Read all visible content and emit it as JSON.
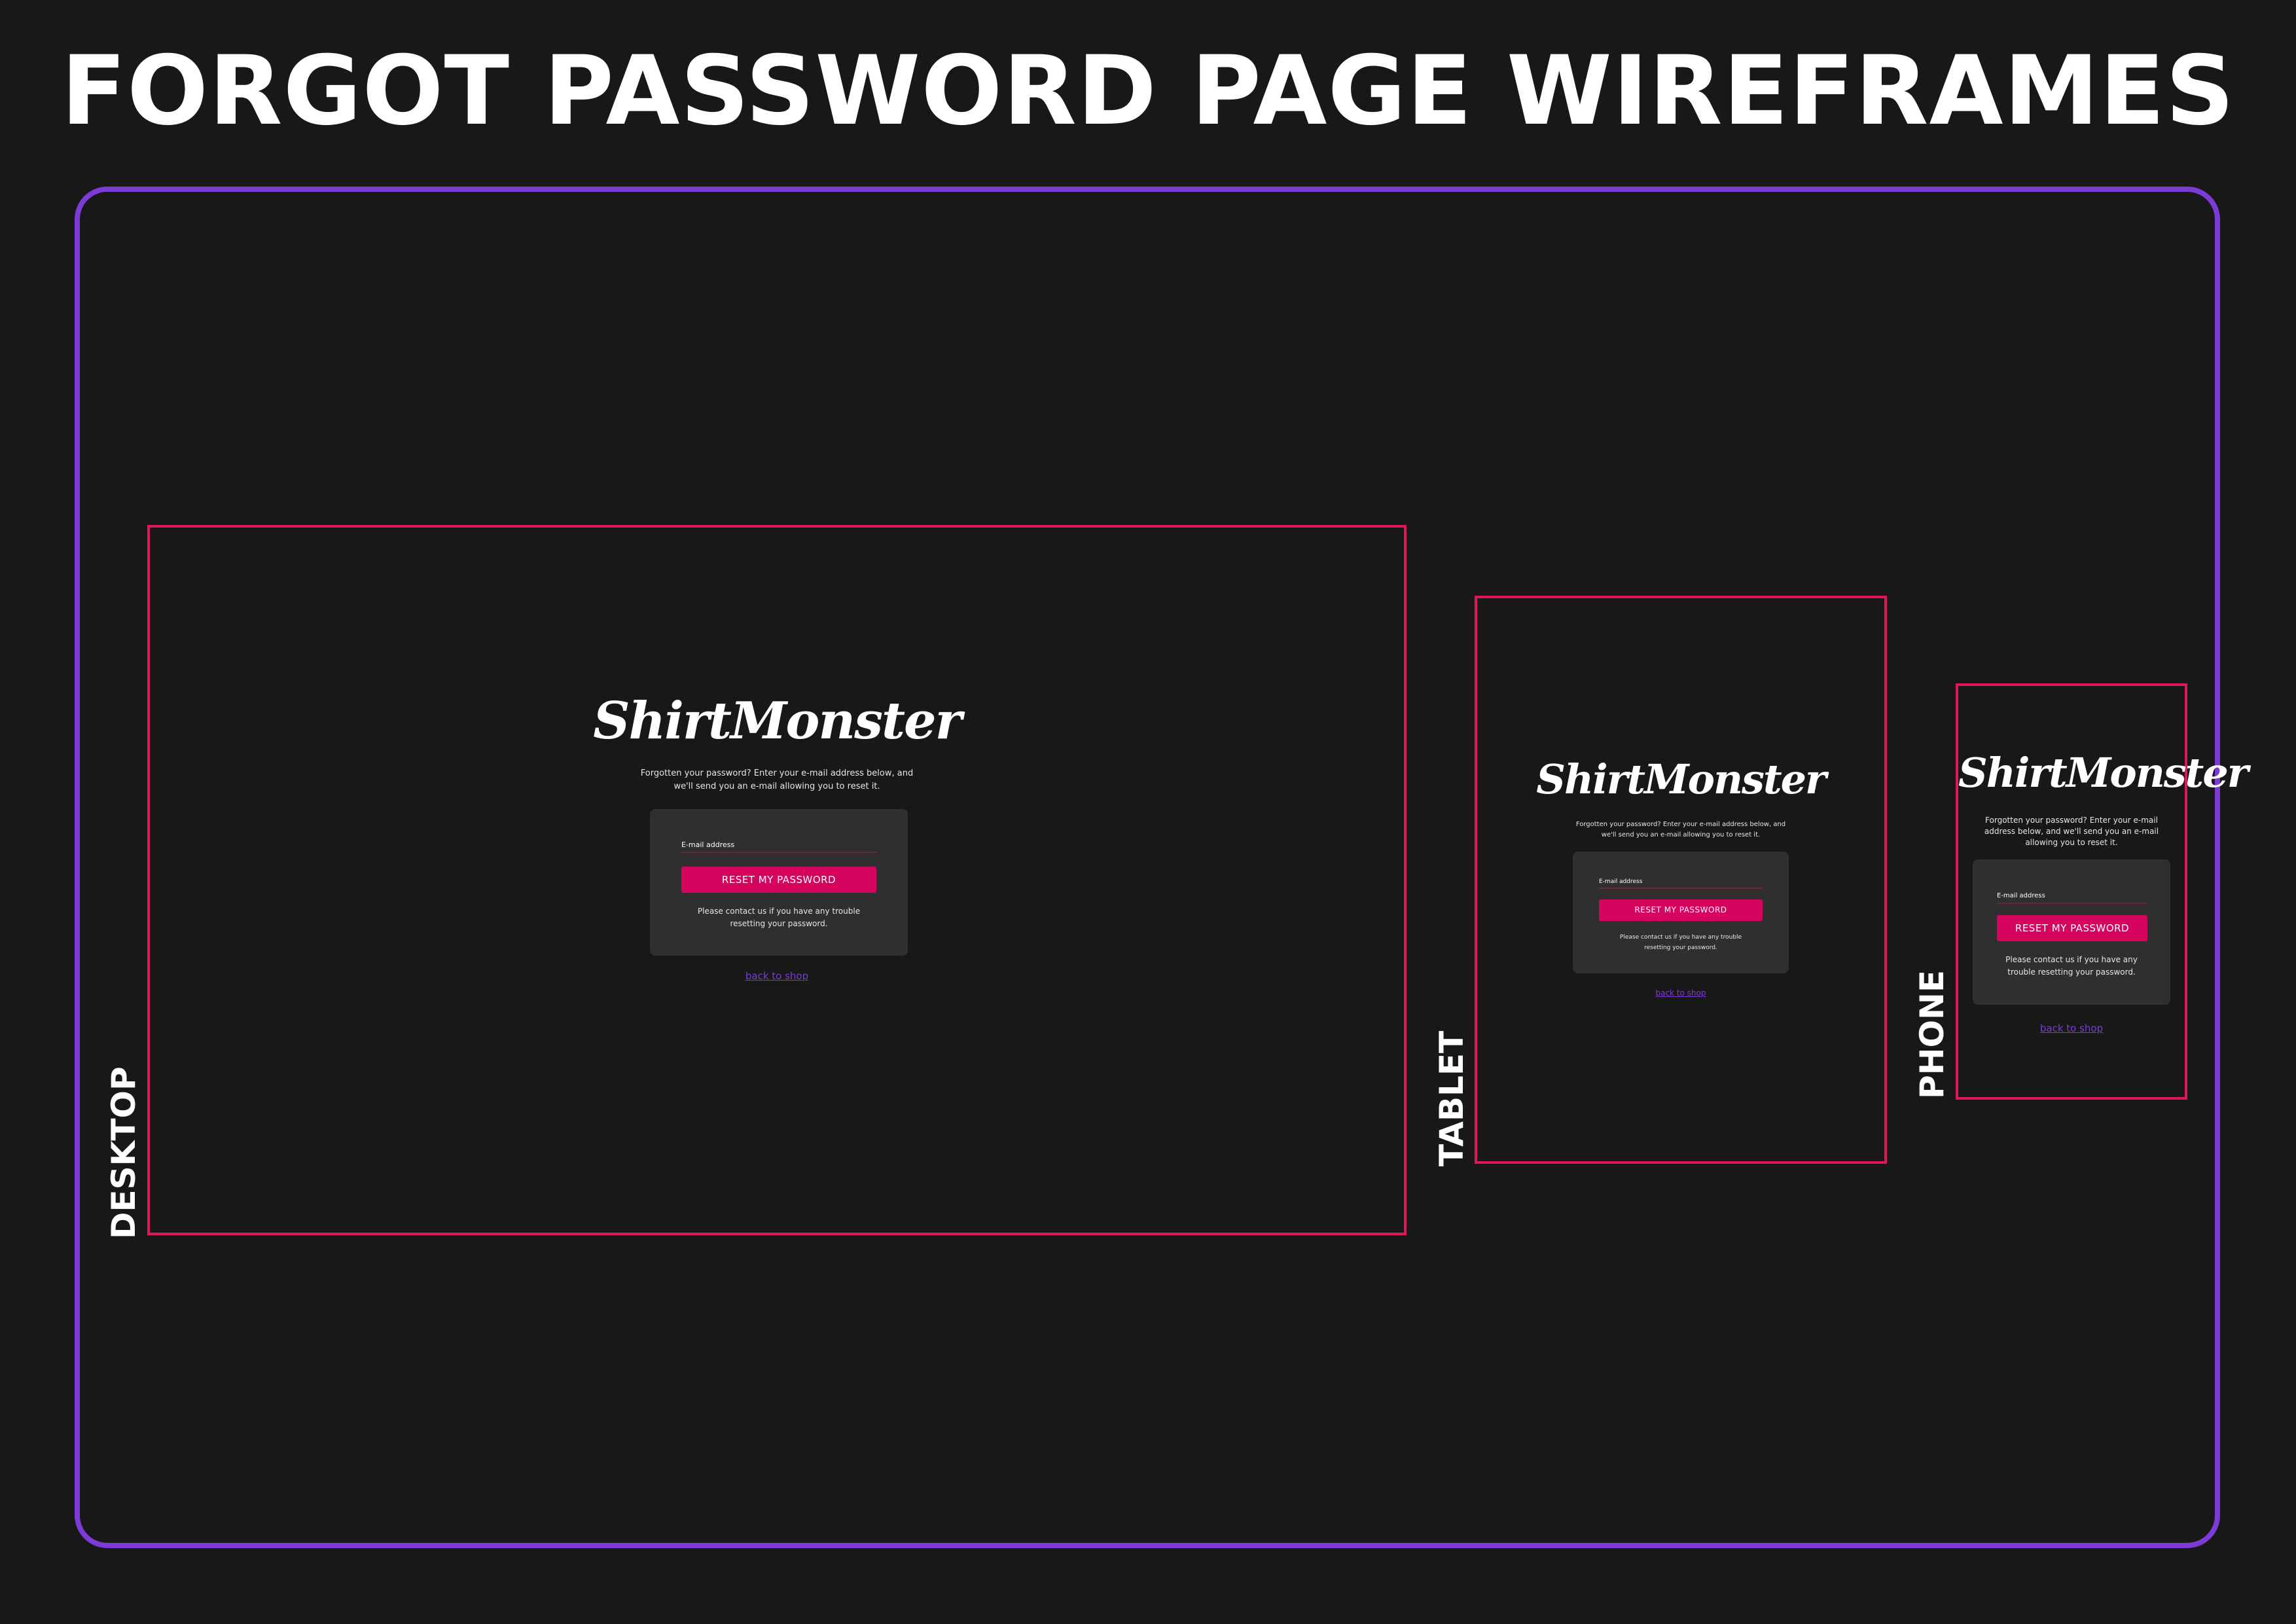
{
  "page": {
    "title": "FORGOT PASSWORD PAGE WIREFRAMES"
  },
  "colors": {
    "background": "#181818",
    "outer_frame": "#7c3bd5",
    "device_frame": "#e0175d",
    "card": "#2f2f2f",
    "button": "#d6045f",
    "link": "#7c3bd5"
  },
  "desktop": {
    "label": "DESKTOP",
    "logo": "ShirtMonster",
    "intro": "Forgotten your password? Enter your e-mail address below, and\nwe'll send you an e-mail allowing you to reset it.",
    "email_label": "E-mail address",
    "button": "RESET MY PASSWORD",
    "help": "Please contact us if you have any trouble\nresetting your password.",
    "back_link": "back to shop"
  },
  "tablet": {
    "label": "TABLET",
    "logo": "ShirtMonster",
    "intro": "Forgotten your password? Enter your e-mail address below, and\nwe'll send you an e-mail allowing you to reset it.",
    "email_label": "E-mail address",
    "button": "RESET MY PASSWORD",
    "help": "Please contact us if you have any trouble\nresetting your password.",
    "back_link": "back to shop"
  },
  "phone": {
    "label": "PHONE",
    "logo": "ShirtMonster",
    "intro": "Forgotten your password? Enter your e-mail\naddress below, and we'll send you an e-mail\nallowing you to reset it.",
    "email_label": "E-mail address",
    "button": "RESET MY PASSWORD",
    "help": "Please contact us if you have any\ntrouble resetting your password.",
    "back_link": "back to shop"
  }
}
